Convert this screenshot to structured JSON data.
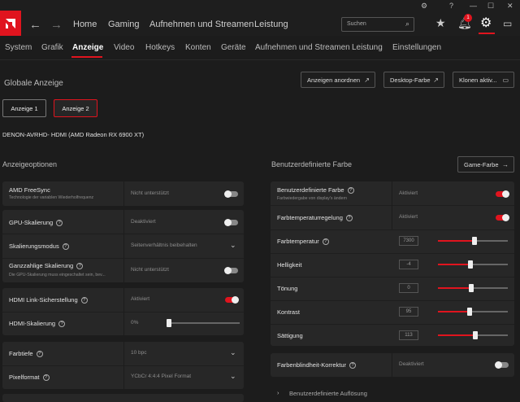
{
  "nav": {
    "home": "Home",
    "gaming": "Gaming",
    "record": "Aufnehmen und Streamen",
    "perf": "Leistung"
  },
  "search": {
    "placeholder": "Suchen"
  },
  "notifications": {
    "count": "1"
  },
  "tabs": [
    "System",
    "Grafik",
    "Anzeige",
    "Video",
    "Hotkeys",
    "Konten",
    "Geräte",
    "Aufnehmen und Streamen",
    "Leistung",
    "Einstellungen"
  ],
  "heading": "Globale Anzeige",
  "top_buttons": {
    "arrange": "Anzeigen anordnen",
    "desktop": "Desktop-Farbe",
    "clone": "Klonen aktiv..."
  },
  "displays": [
    "Anzeige 1",
    "Anzeige 2"
  ],
  "display_name": "DENON-AVRHD- HDMI (AMD Radeon RX 6900 XT)",
  "left_title": "Anzeigeoptionen",
  "right_title": "Benutzerdefinierte Farbe",
  "game_color": "Game-Farbe",
  "left_rows": {
    "freesync": {
      "label": "AMD FreeSync",
      "sub": "Technologie der variablen Wiederholfrequenz",
      "value": "Nicht unterstützt",
      "on": false
    },
    "gpuscale": {
      "label": "GPU-Skalierung",
      "value": "Deaktiviert",
      "on": false
    },
    "scalemode": {
      "label": "Skalierungsmodus",
      "value": "Seitenverhältnis beibehalten"
    },
    "intscale": {
      "label": "Ganzzahlige Skalierung",
      "sub": "Die GPU-Skalierung muss eingeschaltet sein, bev...",
      "value": "Nicht unterstützt",
      "on": false
    },
    "hdmilink": {
      "label": "HDMI Link-Sicherstellung",
      "value": "Aktiviert",
      "on": true
    },
    "hdmiscale": {
      "label": "HDMI-Skalierung",
      "value": "0%",
      "level": 0
    },
    "depth": {
      "label": "Farbtiefe",
      "value": "10 bpc"
    },
    "pixfmt": {
      "label": "Pixelformat",
      "value": "YCbCr 4:4:4 Pixel Format"
    }
  },
  "right_rows": {
    "custom": {
      "label": "Benutzerdefinierte Farbe",
      "sub": "Farbwiedergabe von display's ändern",
      "value": "Aktiviert",
      "on": true
    },
    "temp_ctrl": {
      "label": "Farbtemperaturregelung",
      "value": "Aktiviert",
      "on": true
    },
    "sliders": [
      {
        "label": "Farbtemperatur",
        "value": "7300",
        "level": 0.52
      },
      {
        "label": "Helligkeit",
        "value": "-4",
        "level": 0.46
      },
      {
        "label": "Tönung",
        "value": "0",
        "level": 0.48
      },
      {
        "label": "Kontrast",
        "value": "95",
        "level": 0.45
      },
      {
        "label": "Sättigung",
        "value": "113",
        "level": 0.53
      }
    ],
    "blind": {
      "label": "Farbenblindheit-Korrektur",
      "value": "Deaktiviert",
      "on": false
    }
  },
  "custom_res": "Benutzerdefinierte Auflösung"
}
